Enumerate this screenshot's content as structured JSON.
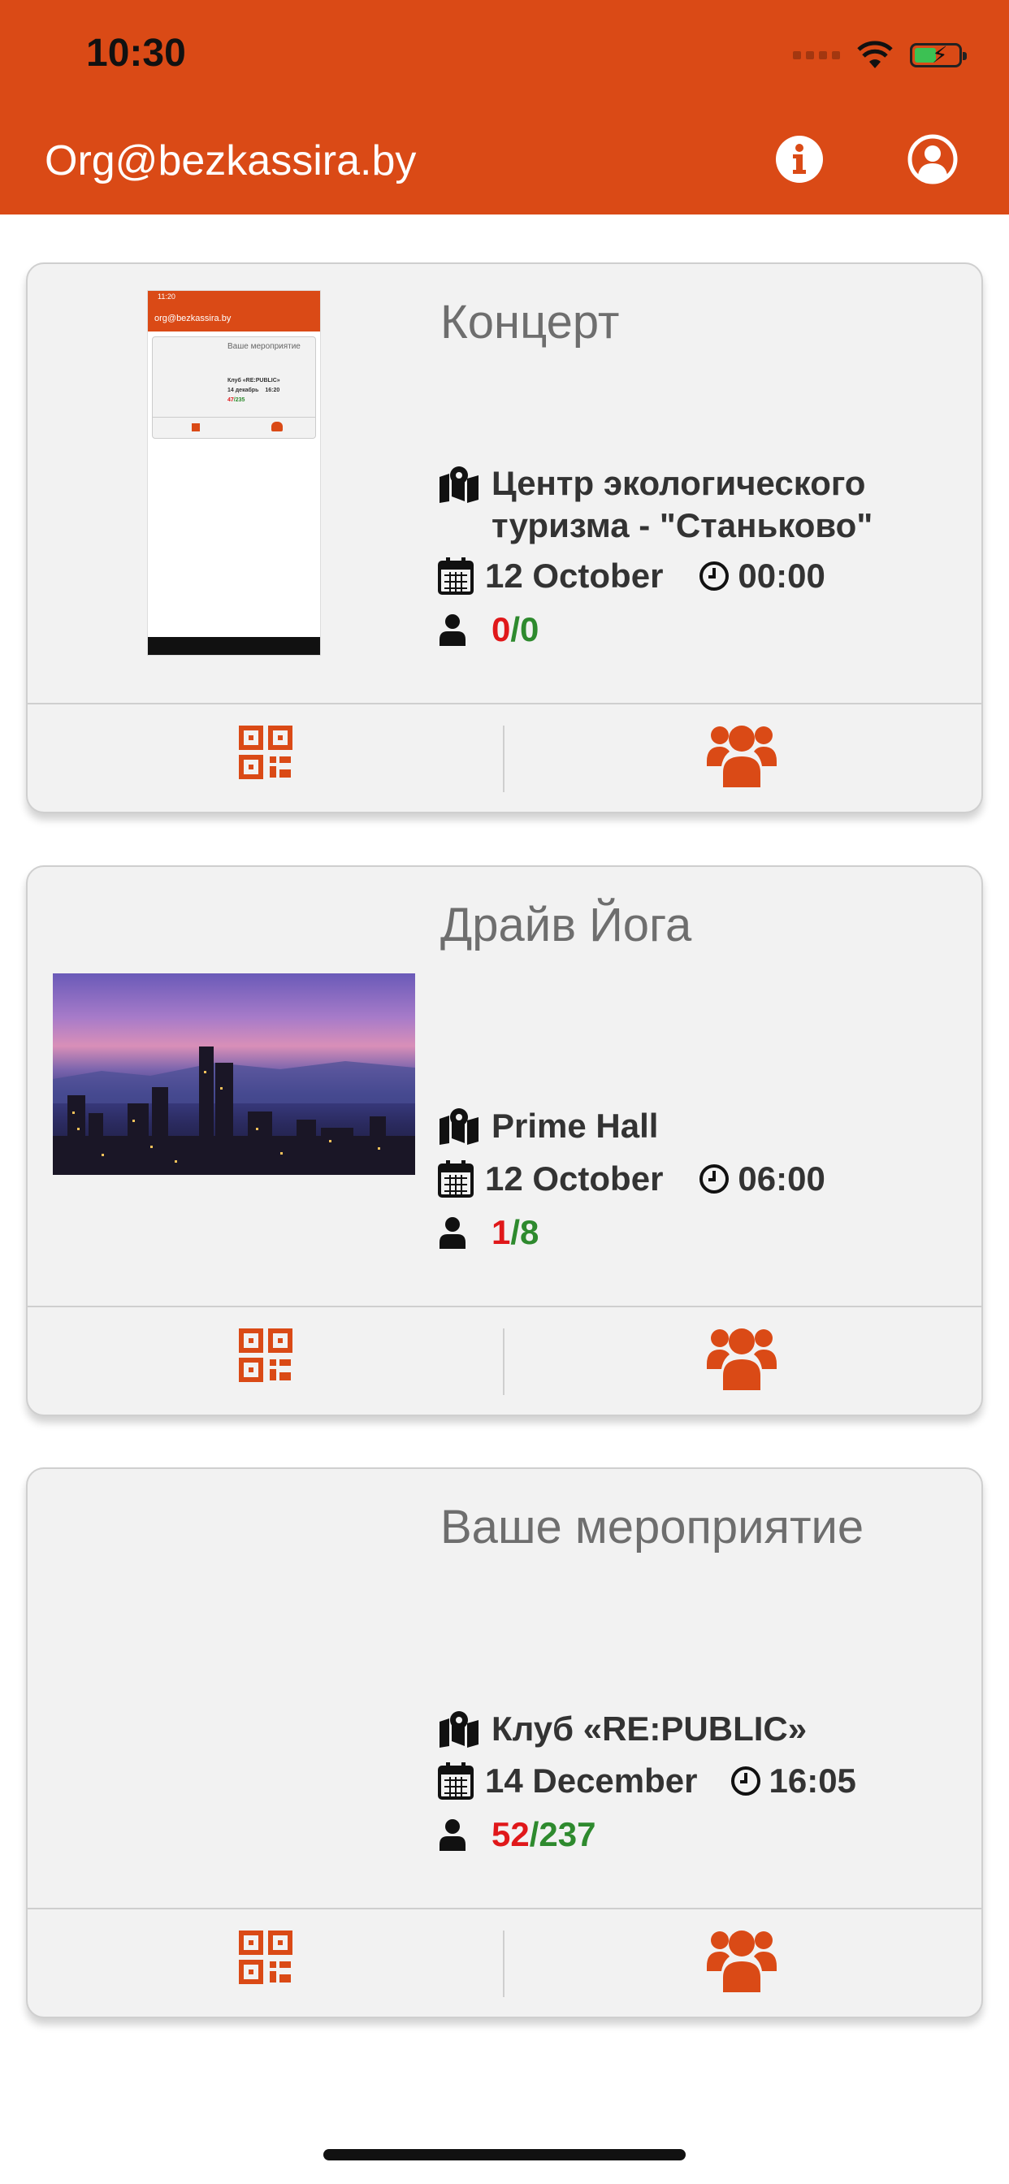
{
  "status_bar": {
    "time": "10:30"
  },
  "header": {
    "title": "Org@bezkassira.by",
    "background": "#DA4A16",
    "info_icon": "info-icon",
    "profile_icon": "user-icon"
  },
  "colors": {
    "accent": "#DA4A16",
    "sold": "#E0181A",
    "total": "#2E8A2E"
  },
  "events": [
    {
      "title": "Концерт",
      "venue": [
        "Центр экологического",
        "туризма - \"Станьково\""
      ],
      "date": "12 October",
      "time": "00:00",
      "sold": "0",
      "total": "0",
      "thumb": {
        "app_title": "org@bezkassira.by",
        "event_title": "Ваше  мероприятие",
        "venue": "Клуб «RE:PUBLIC»",
        "date": "14 декабрь",
        "time": "16:20",
        "sold": "47",
        "total": "235",
        "status_time": "11:20"
      }
    },
    {
      "title": "Драйв Йога",
      "venue": [
        "Prime Hall"
      ],
      "date": "12 October",
      "time": "06:00",
      "sold": "1",
      "total": "8"
    },
    {
      "title": "Ваше  мероприятие",
      "venue": [
        "Клуб «RE:PUBLIC»"
      ],
      "date": "14 December",
      "time": "16:05",
      "sold": "52",
      "total": "237"
    }
  ]
}
